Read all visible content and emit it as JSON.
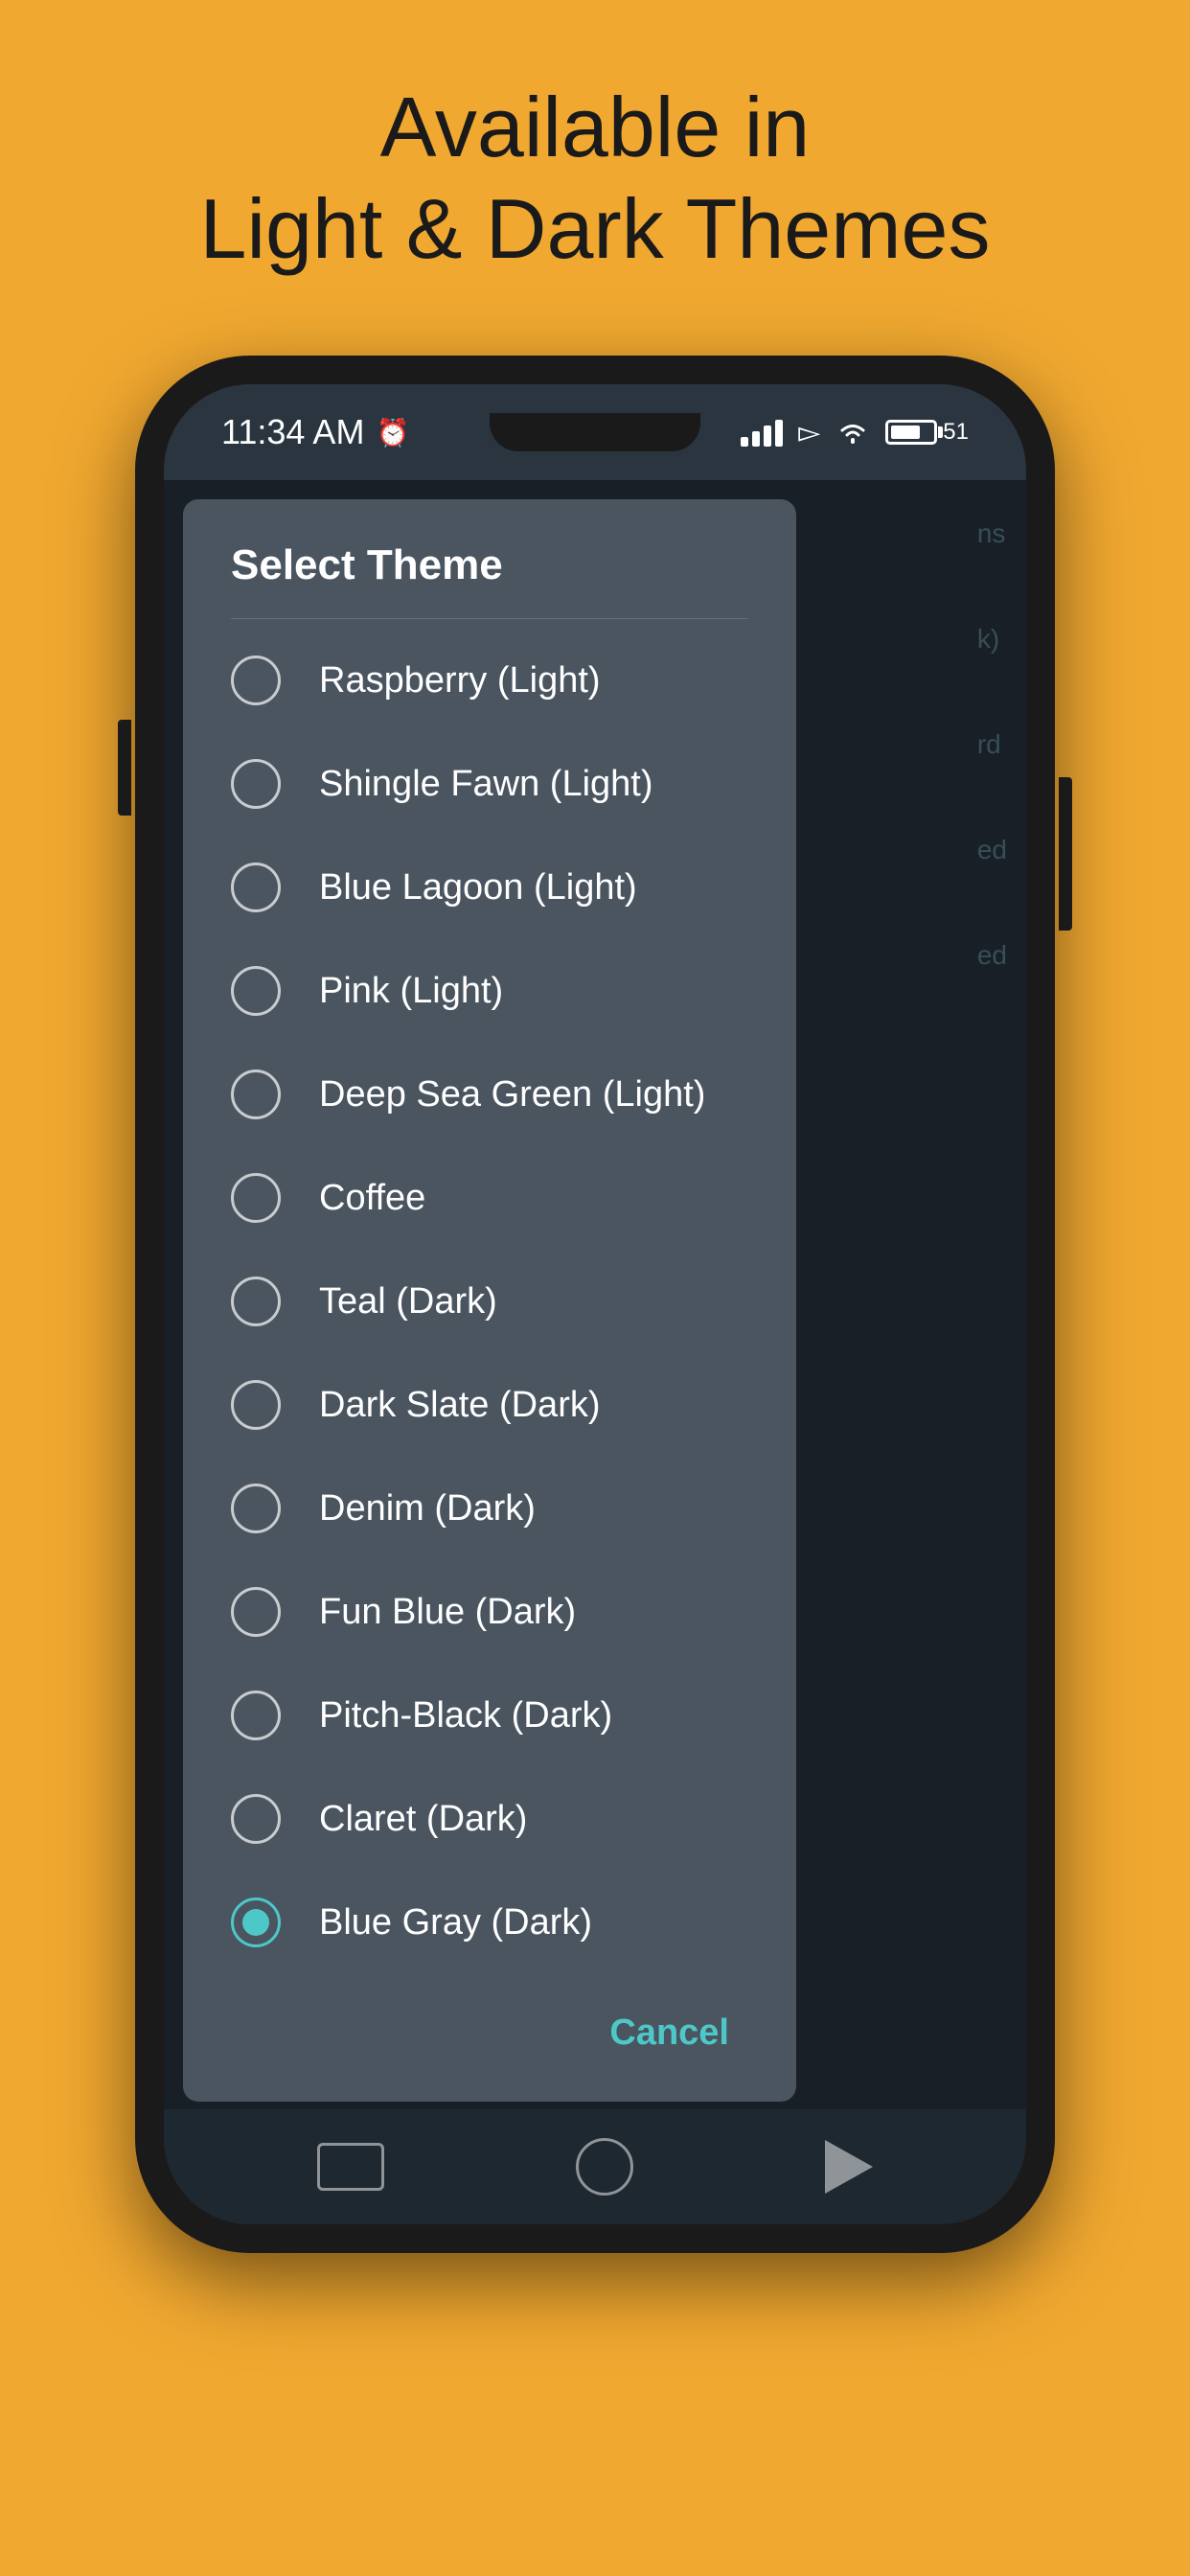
{
  "page": {
    "bg_color": "#F0A830",
    "header_line1": "Available in",
    "header_line2": "Light & Dark Themes"
  },
  "status_bar": {
    "time": "11:34 AM",
    "battery_level": "51"
  },
  "dialog": {
    "title": "Select Theme",
    "themes": [
      {
        "label": "Raspberry (Light)",
        "selected": false
      },
      {
        "label": "Shingle Fawn (Light)",
        "selected": false
      },
      {
        "label": "Blue Lagoon (Light)",
        "selected": false
      },
      {
        "label": "Pink (Light)",
        "selected": false
      },
      {
        "label": "Deep Sea Green (Light)",
        "selected": false
      },
      {
        "label": "Coffee",
        "selected": false
      },
      {
        "label": "Teal (Dark)",
        "selected": false
      },
      {
        "label": "Dark Slate (Dark)",
        "selected": false
      },
      {
        "label": "Denim (Dark)",
        "selected": false
      },
      {
        "label": "Fun Blue (Dark)",
        "selected": false
      },
      {
        "label": "Pitch-Black (Dark)",
        "selected": false
      },
      {
        "label": "Claret (Dark)",
        "selected": false
      },
      {
        "label": "Blue Gray (Dark)",
        "selected": true
      }
    ],
    "cancel_label": "Cancel"
  },
  "right_labels": [
    "ns",
    "k)",
    "rd",
    "ed",
    "ed"
  ],
  "bottom_nav": {
    "rect_label": "rect",
    "circle_label": "circle",
    "triangle_label": "back"
  }
}
